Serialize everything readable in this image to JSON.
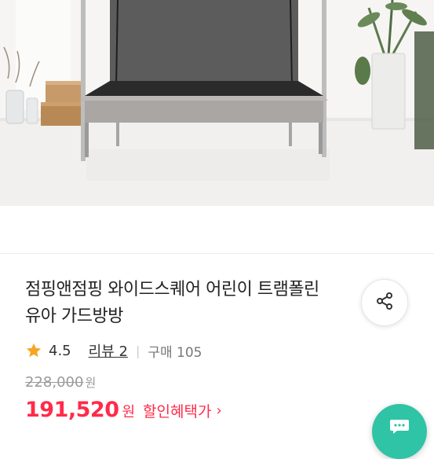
{
  "product": {
    "title": "점핑앤점핑 와이드스퀘어 어린이 트램폴린 유아 가드방방",
    "image_description": "product-photo-trampoline"
  },
  "rating": {
    "score": "4.5",
    "review_label": "리뷰 2",
    "separator": "|",
    "purchase_label": "구매 105"
  },
  "price": {
    "original": "228,000",
    "original_unit": "원",
    "sale": "191,520",
    "sale_unit": "원",
    "discount_link": "할인혜택가",
    "discount_chevron": "›"
  },
  "icons": {
    "share": "share-icon",
    "star": "star-icon",
    "fab": "chat-icon"
  },
  "colors": {
    "accent": "#ff2b4a",
    "star": "#f5a623",
    "fab": "#2ec4a5"
  }
}
